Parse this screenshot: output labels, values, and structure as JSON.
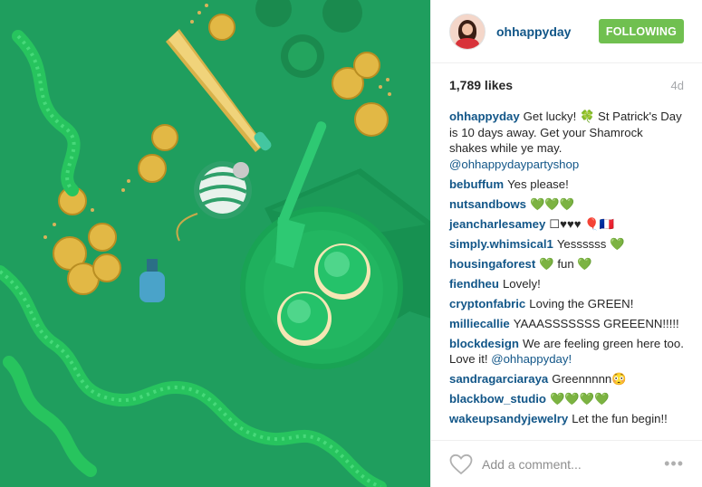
{
  "post": {
    "username": "ohhappyday",
    "follow_label": "FOLLOWING",
    "likes": "1,789 likes",
    "age": "4d",
    "add_comment_placeholder": "Add a comment...",
    "more_label": "•••"
  },
  "caption": {
    "user": "ohhappyday",
    "text": "Get lucky! 🍀 St Patrick's Day is 10 days away. Get your Shamrock shakes while ye may.",
    "mention": "@ohhappydaypartyshop"
  },
  "comments": [
    {
      "user": "bebuffum",
      "text": "Yes please!"
    },
    {
      "user": "nutsandbows",
      "text": "💚💚💚"
    },
    {
      "user": "jeancharlesamey",
      "text": "☐♥♥♥ 🎈🇫🇷"
    },
    {
      "user": "simply.whimsical1",
      "text": "Yessssss 💚"
    },
    {
      "user": "housingaforest",
      "text": "💚 fun 💚"
    },
    {
      "user": "fiendheu",
      "text": "Lovely!"
    },
    {
      "user": "cryptonfabric",
      "text": "Loving the GREEN!"
    },
    {
      "user": "milliecallie",
      "text": "YAAASSSSSSS GREEENN!!!!!"
    },
    {
      "user": "blockdesign",
      "text": "We are feeling green here too. Love it!",
      "mention": "@ohhappyday!"
    },
    {
      "user": "sandragarciaraya",
      "text": "Greennnnn😳"
    },
    {
      "user": "blackbow_studio",
      "text": "💚💚💚💚"
    },
    {
      "user": "wakeupsandyjewelry",
      "text": "Let the fun begin!!"
    }
  ],
  "colors": {
    "photo_bg": "#1f9e5e",
    "username_blue": "#125688",
    "follow_green": "#70c050"
  },
  "icons": {
    "like": "heart-icon",
    "more": "more-options-icon"
  }
}
